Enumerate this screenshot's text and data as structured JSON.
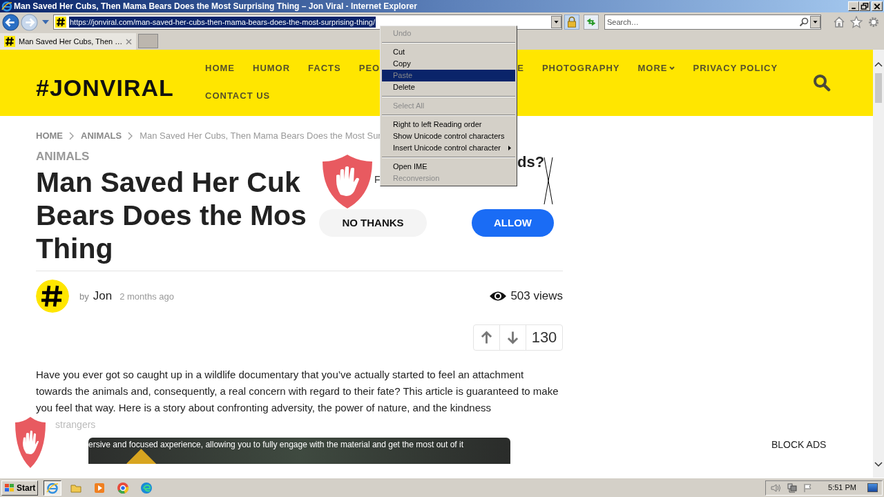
{
  "window": {
    "title": "Man Saved Her Cubs, Then Mama Bears Does the Most Surprising Thing – Jon Viral - Internet Explorer"
  },
  "address_bar": {
    "url": "https://jonviral.com/man-saved-her-cubs-then-mama-bears-does-the-most-surprising-thing/",
    "selected": true
  },
  "search": {
    "placeholder": "Search…"
  },
  "tabs": [
    {
      "label": "Man Saved Her Cubs, Then …",
      "selected": true
    }
  ],
  "site": {
    "logo": "#JONVIRAL",
    "nav": [
      {
        "label": "HOME",
        "caret": false
      },
      {
        "label": "HUMOR",
        "caret": false
      },
      {
        "label": "FACTS",
        "caret": false
      },
      {
        "label": "PEO",
        "caret": false
      },
      {
        "label": "E",
        "caret": false
      },
      {
        "label": "PHOTOGRAPHY",
        "caret": false
      },
      {
        "label": "MORE",
        "caret": true
      },
      {
        "label": "PRIVACY POLICY",
        "caret": false
      },
      {
        "label": "CONTACT US",
        "caret": false
      }
    ]
  },
  "breadcrumb": [
    "HOME",
    "ANIMALS",
    "Man Saved Her Cubs, Then Mama Bears Does the Most Sur"
  ],
  "article": {
    "category": "ANIMALS",
    "title_lines": [
      "Man Saved Her Cuk",
      "Bears Does the Mos",
      "Thing"
    ],
    "author_prefix": "by",
    "author": "Jon",
    "time": "2 months ago",
    "views": "503 views",
    "votes": "130",
    "paragraph": "Have you ever got so caught up in a wildlife documentary that you’ve actually started to feel an attachment towards the animals and, consequently, a real concern with regard to their fate? This article is guaranteed to make you feel that way. Here is a story about confronting adversity, the power of nature, and the kindness",
    "paragraph_tail": "strangers",
    "video_caption": "ersive and focused axperience, allowing you to fully engage with the material and get the most out of it"
  },
  "notification_popup": {
    "title_end": "ds?",
    "subtitle": "F",
    "buttons": [
      {
        "label": "NO THANKS",
        "kind": "secondary"
      },
      {
        "label": "ALLOW",
        "kind": "primary"
      }
    ]
  },
  "block_ads": "BLOCK ADS",
  "context_menu": [
    {
      "kind": "item",
      "label": "Undo",
      "disabled": true,
      "selected": false,
      "submenu": false
    },
    {
      "kind": "separator"
    },
    {
      "kind": "item",
      "label": "Cut",
      "disabled": false,
      "selected": false,
      "submenu": false
    },
    {
      "kind": "item",
      "label": "Copy",
      "disabled": false,
      "selected": false,
      "submenu": false
    },
    {
      "kind": "item",
      "label": "Paste",
      "disabled": true,
      "selected": true,
      "submenu": false
    },
    {
      "kind": "item",
      "label": "Delete",
      "disabled": false,
      "selected": false,
      "submenu": false
    },
    {
      "kind": "separator"
    },
    {
      "kind": "item",
      "label": "Select All",
      "disabled": true,
      "selected": false,
      "submenu": false
    },
    {
      "kind": "separator"
    },
    {
      "kind": "item",
      "label": "Right to left Reading order",
      "disabled": false,
      "selected": false,
      "submenu": false
    },
    {
      "kind": "item",
      "label": "Show Unicode control characters",
      "disabled": false,
      "selected": false,
      "submenu": false
    },
    {
      "kind": "item",
      "label": "Insert Unicode control character",
      "disabled": false,
      "selected": false,
      "submenu": true
    },
    {
      "kind": "separator"
    },
    {
      "kind": "item",
      "label": "Open IME",
      "disabled": false,
      "selected": false,
      "submenu": false
    },
    {
      "kind": "item",
      "label": "Reconversion",
      "disabled": true,
      "selected": false,
      "submenu": false
    }
  ],
  "taskbar": {
    "start": "Start",
    "apps": [
      {
        "kind": "ie",
        "selected": true
      },
      {
        "kind": "folder",
        "selected": false
      },
      {
        "kind": "media",
        "selected": false
      },
      {
        "kind": "chrome",
        "selected": false
      },
      {
        "kind": "edge",
        "selected": false
      }
    ],
    "clock": "5:51 PM"
  }
}
